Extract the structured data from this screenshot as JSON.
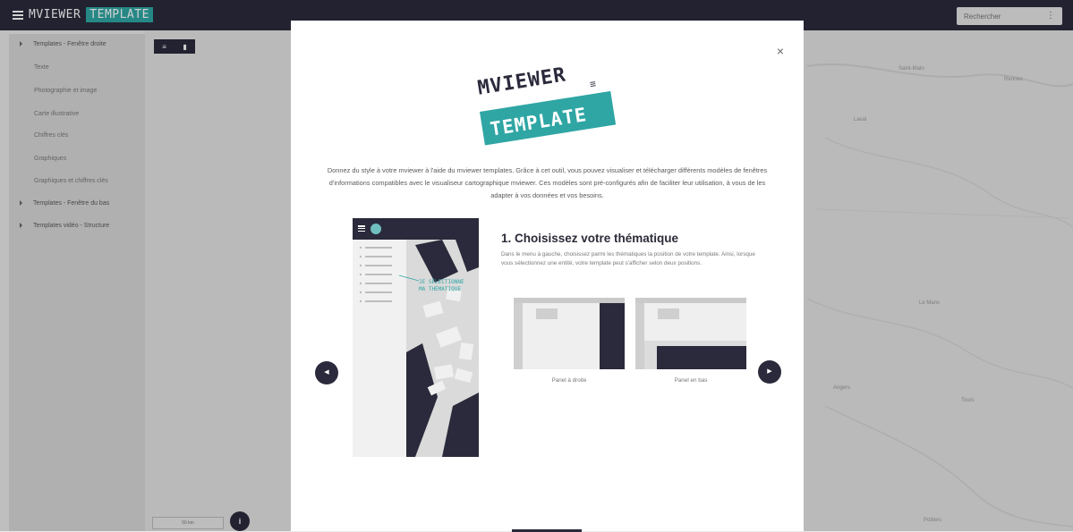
{
  "topbar": {
    "brand_part1": "MVIEWER",
    "brand_part2": "TEMPLATE",
    "search_placeholder": "Rechercher",
    "menu_glyph": "⋮"
  },
  "sidebar": {
    "items": [
      {
        "label": "Templates - Fenêtre droite",
        "group": true
      },
      {
        "label": "Texte",
        "group": false
      },
      {
        "label": "Photographie et image",
        "group": false
      },
      {
        "label": "Carte illustrative",
        "group": false
      },
      {
        "label": "Chiffres clés",
        "group": false
      },
      {
        "label": "Graphiques",
        "group": false
      },
      {
        "label": "Graphiques et chiffres clés",
        "group": false
      },
      {
        "label": "Templates - Fenêtre du bas",
        "group": true
      },
      {
        "label": "Templates vidéo - Structure",
        "group": true
      }
    ]
  },
  "map": {
    "toolbar_icons": [
      "≡",
      "▮"
    ],
    "labels": [
      "Saint-Malo",
      "Rennes",
      "Laval",
      "Le Mans",
      "Angers",
      "Tours",
      "Poitiers"
    ],
    "scale_text": "50 km",
    "info_label": "i"
  },
  "modal": {
    "close_label": "×",
    "logo_line1": "MVIEWER",
    "logo_line2": "TEMPLATE",
    "intro": "Donnez du style à votre mviewer à l'aide du mviewer templates. Grâce à cet outil, vous pouvez visualiser et télécharger différents modèles de fenêtres d'informations compatibles avec le visualiseur cartographique mviewer. Ces modèles sont pré-configurés afin de faciliter leur utilisation, à vous de les adapter à vos données et vos besoins.",
    "phone_note_line1": "JE SÉLECTIONNE",
    "phone_note_line2": "MA THÉMATIQUE",
    "step_title": "1. Choisissez votre thématique",
    "step_desc": "Dans le menu à gauche, choisissez parmi les thématiques la position de votre template. Ainsi, lorsque vous sélectionnez une entité, votre template peut s'afficher selon deux positions.",
    "options": [
      {
        "caption": "Panel à droite"
      },
      {
        "caption": "Panel en bas"
      }
    ],
    "prev_label": "◀",
    "next_label": "▶"
  },
  "colors": {
    "dark": "#2a2a3c",
    "accent": "#2fa6a4"
  }
}
